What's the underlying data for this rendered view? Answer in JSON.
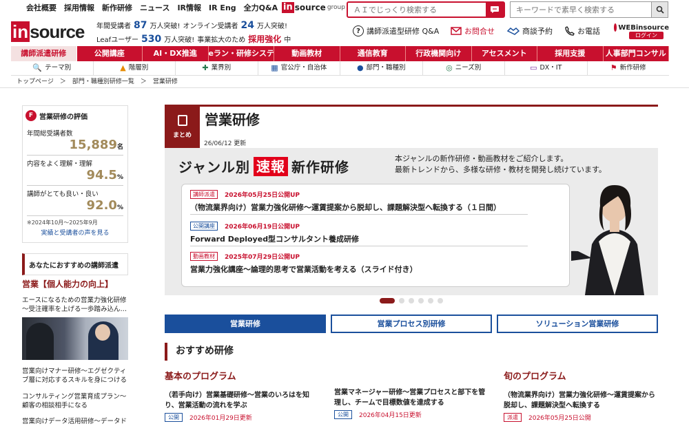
{
  "topnav": [
    "会社概要",
    "採用情報",
    "新作研修",
    "ニュース",
    "IR情報",
    "IR Eng",
    "全力Q&A"
  ],
  "logo_small": {
    "i": "in",
    "text": "source",
    "group": "group"
  },
  "ai_search": {
    "placeholder": "ＡＩでじっくり検索する"
  },
  "kw_search": {
    "placeholder": "キーワードで素早く検索する"
  },
  "logo_big": {
    "i": "in",
    "text": "source"
  },
  "stats": {
    "r1a": "年間受講者",
    "r1n": "87",
    "r1b": "万人突破!",
    "r1c": "オンライン受講者",
    "r1n2": "24",
    "r1d": "万人突破!",
    "r2a": "Leafユーザー",
    "r2n": "530",
    "r2b": "万人突破!",
    "r2c": "事業拡大のため",
    "r2r": "採用強化",
    "r2d": "中"
  },
  "hdr": {
    "qa": "講師派遣型研修 Q&A",
    "contact": "お問合せ",
    "consult": "商談予約",
    "tel": "お電話",
    "web_top": "WEBinsource",
    "web_login": "ログイン"
  },
  "mainnav": [
    "講師派遣研修",
    "公開講座",
    "AI・DX推進",
    "eラン・研修システム",
    "動画教材",
    "通信教育",
    "行政機関向け",
    "アセスメント",
    "採用支援",
    "人事部門コンサル"
  ],
  "subnav": [
    {
      "icon": "🔍",
      "label": "テーマ別"
    },
    {
      "icon": "▲",
      "label": "階層別"
    },
    {
      "icon": "✚",
      "label": "業界別"
    },
    {
      "icon": "▦",
      "label": "官公庁・自治体"
    },
    {
      "icon": "●",
      "label": "部門・職種別"
    },
    {
      "icon": "◎",
      "label": "ニーズ別"
    },
    {
      "icon": "▭",
      "label": "DX・IT"
    },
    {
      "icon": "⚑",
      "label": "新作研修"
    }
  ],
  "crumbs": "トップページ　＞　部門・職種別研修一覧　＞　営業研修",
  "eval": {
    "title": "営業研修の評価",
    "s1_label": "年間総受講者数",
    "s1_val": "15,889",
    "s1_unit": "名",
    "s2_label": "内容をよく理解・理解",
    "s2_val": "94.5",
    "s2_unit": "%",
    "s3_label": "講師がとても良い・良い",
    "s3_val": "92.0",
    "s3_unit": "%",
    "note": "※2024年10月～2025年9月",
    "link": "実績と受講者の声を見る"
  },
  "reco": {
    "title": "あなたにおすすめの講師派遣",
    "cat": "営業【個人能力の向上】",
    "item1": "エースになるための営業力強化研修～受注確率を上げる一歩踏み込ん…",
    "item2": "営業向けマナー研修～エグゼクティブ層に対応するスキルを身につける",
    "item3": "コンサルティング営業育成プラン～顧客の相談相手になる",
    "item4": "営業向けデータ活用研修～データド"
  },
  "page": {
    "matome": "まとめ",
    "title": "営業研修",
    "updated": "26/06/12 更新"
  },
  "banner": {
    "t1": "ジャンル別",
    "t_red": "速報",
    "t2": "新作研修",
    "desc1": "本ジャンルの新作研修・動画教材をご紹介します。",
    "desc2": "最新トレンドから、多様な研修・教材を開発し続けています。",
    "items": [
      {
        "tag": "講師派遣",
        "date": "2026年05月25日公開UP",
        "title": "（物流業界向け）営業力強化研修～運賃提案から脱却し、課題解決型へ転換する（１日間）"
      },
      {
        "tag": "公開講座",
        "date": "2026年06月19日公開UP",
        "title": "Forward Deployed型コンサルタント養成研修"
      },
      {
        "tag": "動画教材",
        "date": "2025年07月29日公開UP",
        "title": "営業力強化講座～論理的思考で営業活動を考える（スライド付き）"
      }
    ]
  },
  "tabs": [
    "営業研修",
    "営業プロセス別研修",
    "ソリューション営業研修"
  ],
  "osusume": "おすすめ研修",
  "cols": [
    {
      "head": "基本のプログラム",
      "title": "（若手向け）営業基礎研修～営業のいろはを知り、営業活動の流れを学ぶ",
      "tag": "公開",
      "date": "2026年01月29日更新"
    },
    {
      "head": "",
      "title": "営業マネージャー研修～営業プロセスと部下を管理し、チームで目標数値を達成する",
      "tag": "公開",
      "date": "2026年04月15日更新"
    },
    {
      "head": "旬のプログラム",
      "title": "（物流業界向け）営業力強化研修～運賃提案から脱却し、課題解決型へ転換する",
      "tag": "派遣",
      "date": "2026年05月25日公開"
    }
  ],
  "colors": {
    "brand": "#c8102e",
    "dark_red": "#8b1a1a",
    "blue": "#1a4f9c",
    "gold": "#a28a5a"
  }
}
